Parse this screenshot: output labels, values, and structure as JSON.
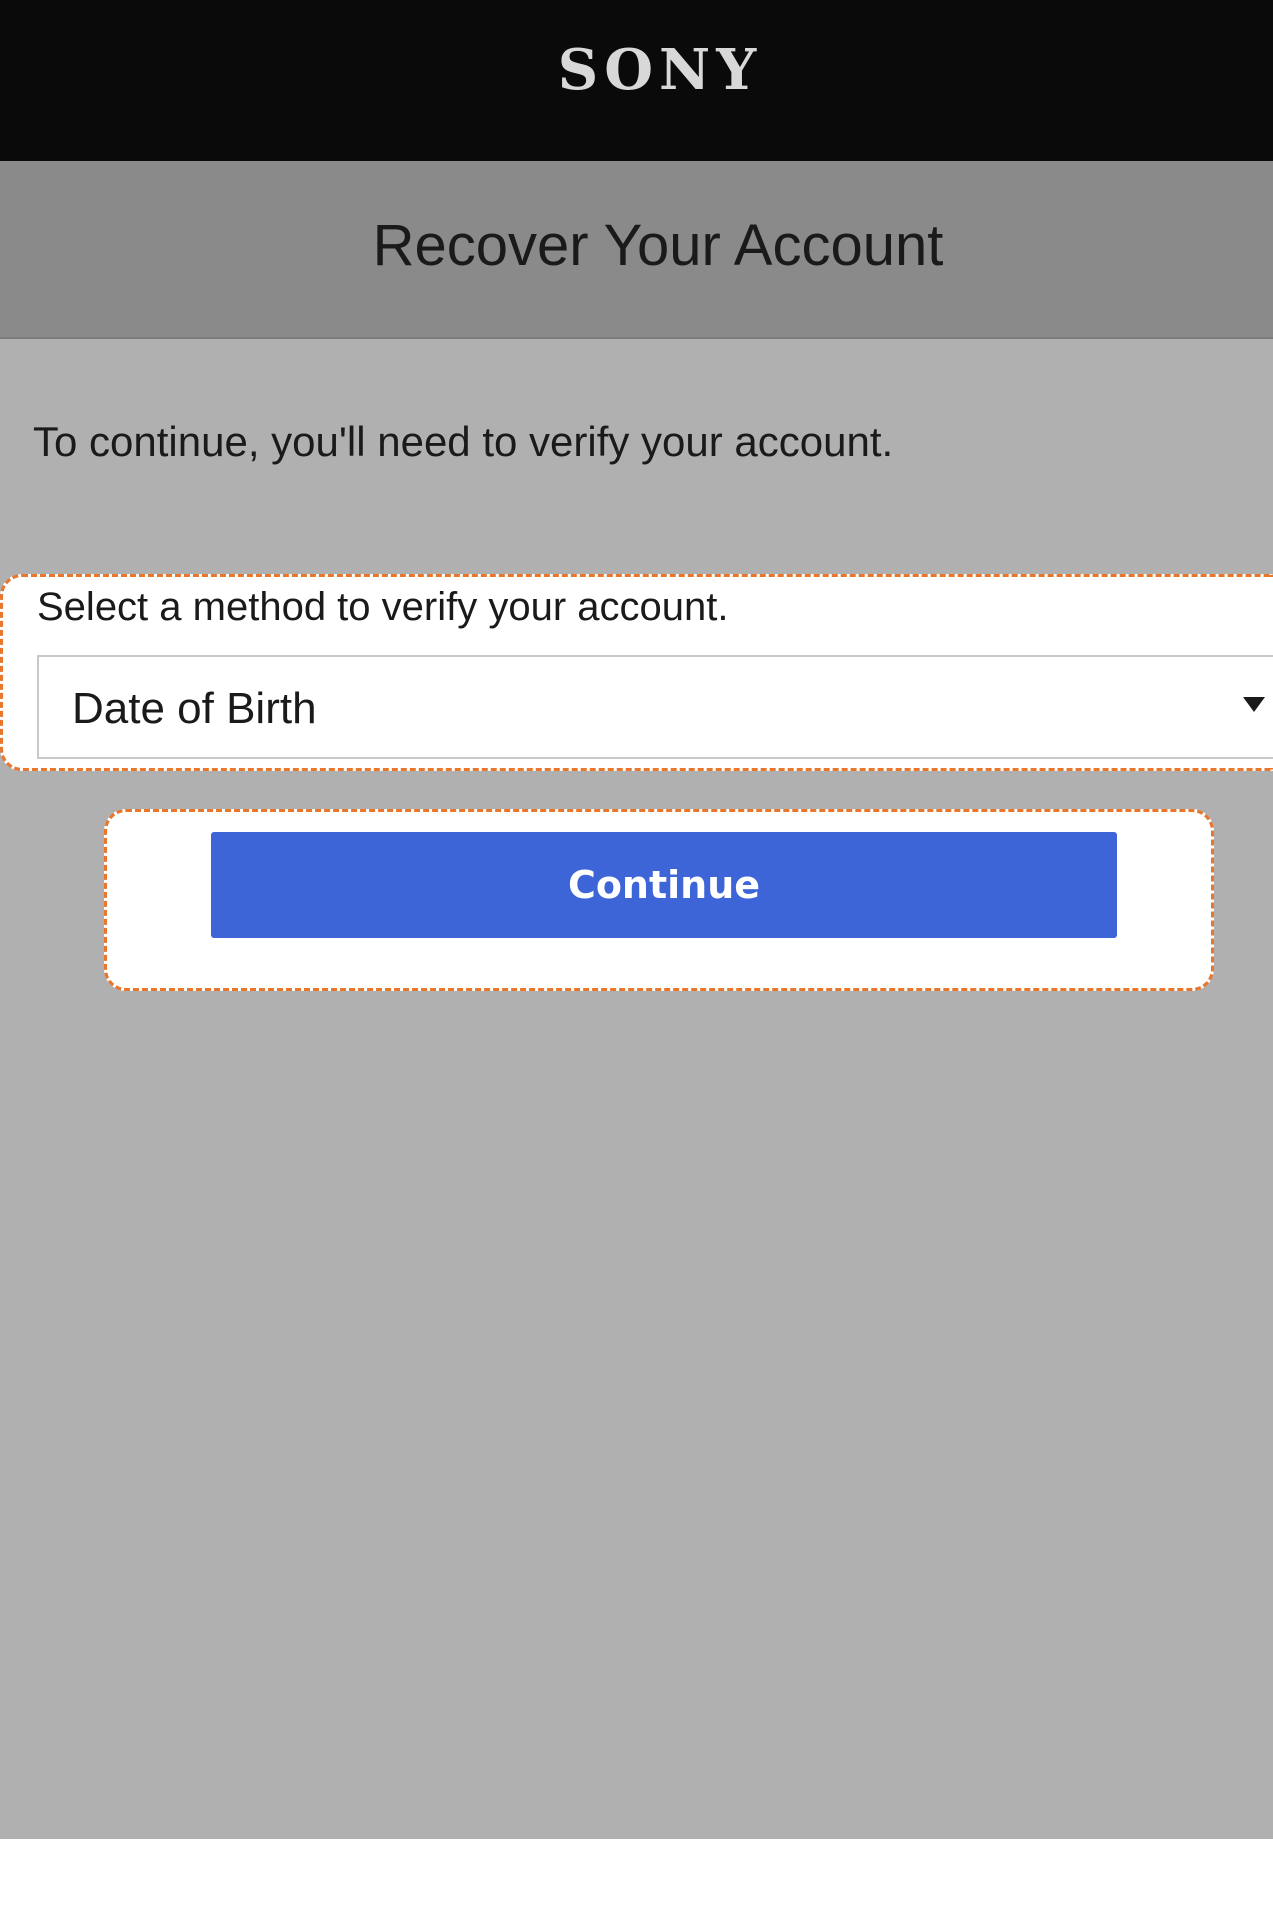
{
  "header": {
    "logo": "SONY"
  },
  "title": "Recover Your Account",
  "intro_text": "To continue, you'll need to verify your account.",
  "verify": {
    "label": "Select a method to verify your account.",
    "selected_method": "Date of Birth"
  },
  "continue_label": "Continue",
  "colors": {
    "header_bg": "#0a0a0a",
    "title_bg": "#8a8a8a",
    "content_bg": "#b0b0b0",
    "button_bg": "#3e65d8",
    "highlight_border": "#e8762c"
  }
}
